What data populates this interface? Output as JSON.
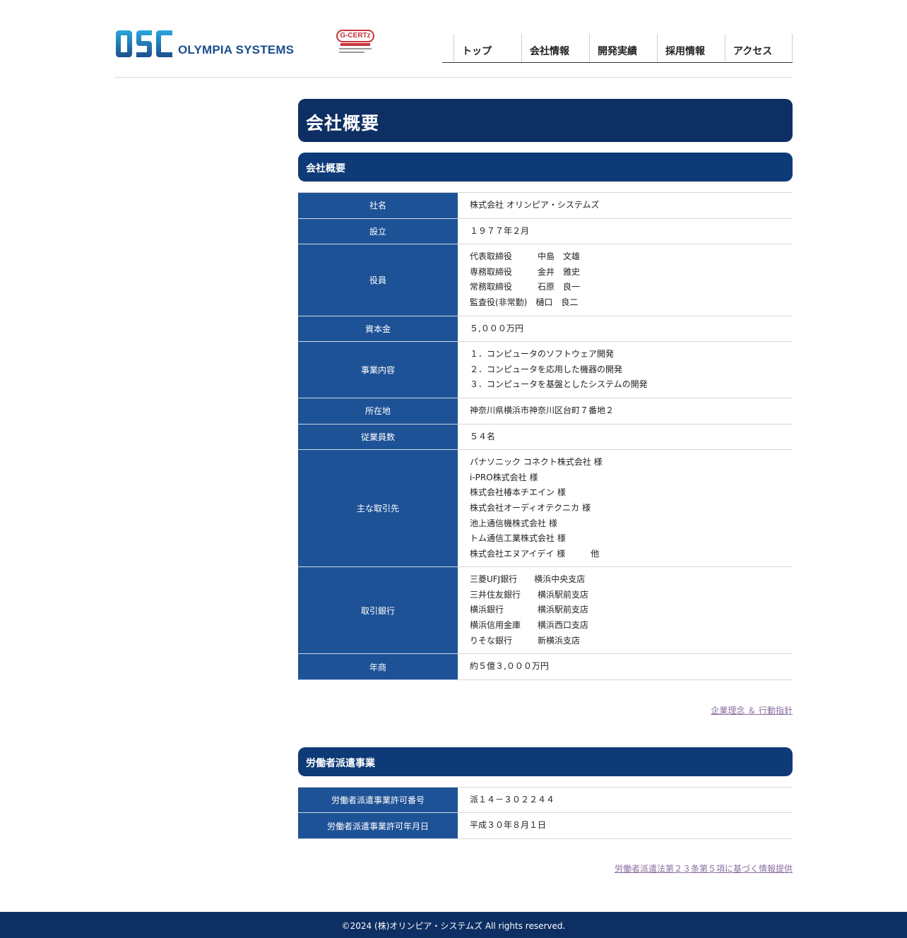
{
  "header": {
    "logo_text": "OLYMPIA SYSTEMS",
    "logo_mark": "OSC",
    "cert_label": "G-CERTz",
    "nav": [
      {
        "label": "トップ"
      },
      {
        "label": "会社情報"
      },
      {
        "label": "開発実績"
      },
      {
        "label": "採用情報"
      },
      {
        "label": "アクセス"
      }
    ]
  },
  "main": {
    "page_title": "会社概要",
    "section1_title": "会社概要",
    "company_rows": [
      {
        "label": "社名",
        "lines": [
          "株式会社 オリンピア・システムズ"
        ]
      },
      {
        "label": "設立",
        "lines": [
          "１９７７年２月"
        ]
      },
      {
        "label": "役員",
        "lines": [
          "代表取締役　　　中島　文雄",
          "専務取締役　　　金井　雅史",
          "常務取締役　　　石原　良一",
          "監査役(非常勤)　樋口　良二"
        ]
      },
      {
        "label": "資本金",
        "lines": [
          "５,０００万円"
        ]
      },
      {
        "label": "事業内容",
        "lines": [
          "１．コンピュータのソフトウェア開発",
          "２．コンピュータを応用した機器の開発",
          "３．コンピュータを基盤としたシステムの開発"
        ]
      },
      {
        "label": "所在地",
        "lines": [
          "神奈川県横浜市神奈川区台町７番地２"
        ]
      },
      {
        "label": "従業員数",
        "lines": [
          "５４名"
        ]
      },
      {
        "label": "主な取引先",
        "lines": [
          "パナソニック コネクト株式会社 様",
          "i-PRO株式会社 様",
          "株式会社椿本チエイン 様",
          "株式会社オーディオテクニカ 様",
          "池上通信機株式会社 様",
          "トム通信工業株式会社 様",
          "株式会社エヌアイデイ 様　　　他"
        ]
      },
      {
        "label": "取引銀行",
        "lines": [
          "三菱UFJ銀行　　横浜中央支店",
          "三井住友銀行　　横浜駅前支店",
          "横浜銀行　　　　横浜駅前支店",
          "横浜信用金庫　　横浜西口支店",
          "りそな銀行　　　新横浜支店"
        ]
      },
      {
        "label": "年商",
        "lines": [
          "約５億３,０００万円"
        ]
      }
    ],
    "link1": "企業理念 ＆ 行動指針",
    "section2_title": "労働者派遣事業",
    "dispatch_rows": [
      {
        "label": "労働者派遣事業許可番号",
        "lines": [
          "派１４－３０２２４４"
        ]
      },
      {
        "label": "労働者派遣事業許可年月日",
        "lines": [
          "平成３０年８月１日"
        ]
      }
    ],
    "link2": "労働者派遣法第２３条第５項に基づく情報提供"
  },
  "footer": {
    "copyright": "©2024 (株)オリンピア・システムズ All rights reserved."
  },
  "colors": {
    "title_bg": "#0e2f63",
    "section_bg": "#0e3a78",
    "th_bg": "#1e5296",
    "link": "#8a6ea0",
    "footer_bg": "#0e2f63",
    "logo_blue": "#1b4f8f"
  }
}
